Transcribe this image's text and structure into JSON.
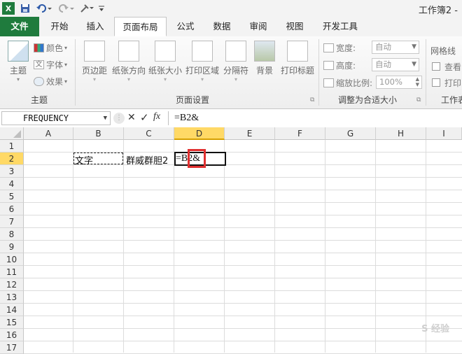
{
  "title_bar": {
    "app_icon": "excel-icon",
    "window_title": "工作簿2 -",
    "quick_access": [
      "save-icon",
      "undo-icon",
      "redo-icon",
      "format-painter-icon",
      "customize-icon"
    ]
  },
  "ribbon_tabs": [
    {
      "label": "文件",
      "active": false
    },
    {
      "label": "开始",
      "active": false
    },
    {
      "label": "插入",
      "active": false
    },
    {
      "label": "页面布局",
      "active": true
    },
    {
      "label": "公式",
      "active": false
    },
    {
      "label": "数据",
      "active": false
    },
    {
      "label": "审阅",
      "active": false
    },
    {
      "label": "视图",
      "active": false
    },
    {
      "label": "开发工具",
      "active": false
    }
  ],
  "ribbon": {
    "themes_group": {
      "label": "主题",
      "theme_button": "主题",
      "colors": "颜色",
      "fonts": "字体",
      "effects": "效果"
    },
    "page_setup_group": {
      "label": "页面设置",
      "buttons": [
        "页边距",
        "纸张方向",
        "纸张大小",
        "打印区域",
        "分隔符",
        "背景",
        "打印标题"
      ]
    },
    "scale_group": {
      "label": "调整为合适大小",
      "width_label": "宽度:",
      "width_value": "自动",
      "height_label": "高度:",
      "height_value": "自动",
      "scale_label": "缩放比例:",
      "scale_value": "100%"
    },
    "sheet_options_group": {
      "label": "工作表",
      "gridlines": "网格线",
      "view": "查看",
      "print": "打印"
    }
  },
  "formula_bar": {
    "name_box": "FREQUENCY",
    "cancel_symbol": "✕",
    "enter_symbol": "✓",
    "fx_label": "fx",
    "formula": "=B2&"
  },
  "grid": {
    "columns": [
      "A",
      "B",
      "C",
      "D",
      "E",
      "F",
      "G",
      "H",
      "I"
    ],
    "rows": [
      "1",
      "2",
      "3",
      "4",
      "5",
      "6",
      "7",
      "8",
      "9",
      "10",
      "11",
      "12",
      "13",
      "14",
      "15",
      "16",
      "17"
    ],
    "active_column": "D",
    "active_row": "2",
    "cells": {
      "B2": "文字",
      "C2": "群威群胆2",
      "D2": "=B2&"
    }
  },
  "colors": {
    "file_tab": "#1f7b3d",
    "active_col_header": "#ffd966",
    "highlight_box": "#e03030"
  },
  "watermark": "S 经验"
}
